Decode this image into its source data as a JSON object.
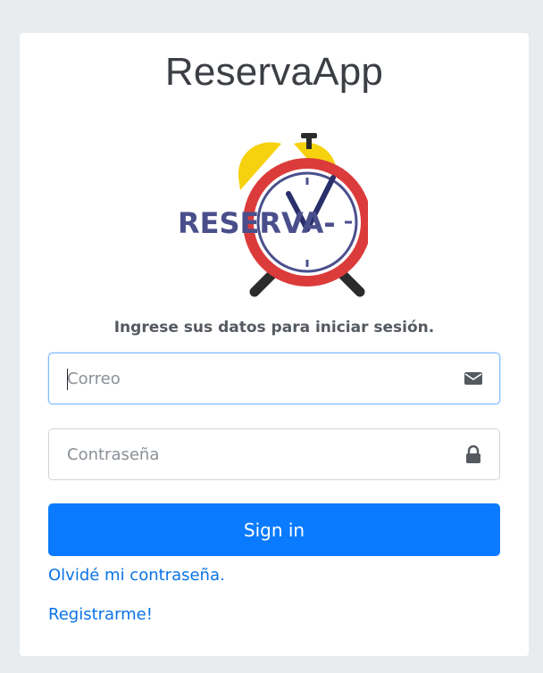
{
  "app": {
    "title_bold": "Reserva",
    "title_light": "App"
  },
  "logo": {
    "text": "RESERVA-",
    "icon": "alarm-clock-logo",
    "colors": {
      "bell": "#f5d20d",
      "ring": "#dc3b3b",
      "face": "#ffffff",
      "text": "#4a4f8c",
      "hands": "#2a2f6b",
      "legs": "#2b2b2b"
    }
  },
  "login": {
    "message": "Ingrese sus datos para iniciar sesión.",
    "email_placeholder": "Correo",
    "email_value": "",
    "email_icon": "envelope-icon",
    "password_placeholder": "Contraseña",
    "password_value": "",
    "password_icon": "lock-icon",
    "signin_label": "Sign in",
    "forgot_label": "Olvidé mi contraseña.",
    "register_label": "Registrarme!"
  },
  "theme": {
    "primary": "#0a7bff",
    "link": "#0b73e6",
    "background": "#e9ecef",
    "card": "#ffffff"
  }
}
